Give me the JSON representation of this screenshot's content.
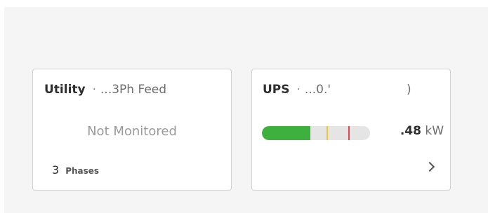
{
  "utility_card": {
    "title": "Utility",
    "separator": "·",
    "subtitle": "...3Ph Feed",
    "status": "Not Monitored",
    "phases_count": "3",
    "phases_label": "Phases"
  },
  "ups_card": {
    "title": "UPS",
    "separator": "·",
    "subtitle": "...0.'",
    "subtitle_close": ")",
    "load_fraction": 0.45,
    "power_value": ".48",
    "power_unit": "kW",
    "colors": {
      "load": "#3eb03e",
      "warning": "#f2c230",
      "critical": "#e0474c"
    },
    "icon": "chevron-right-icon"
  }
}
